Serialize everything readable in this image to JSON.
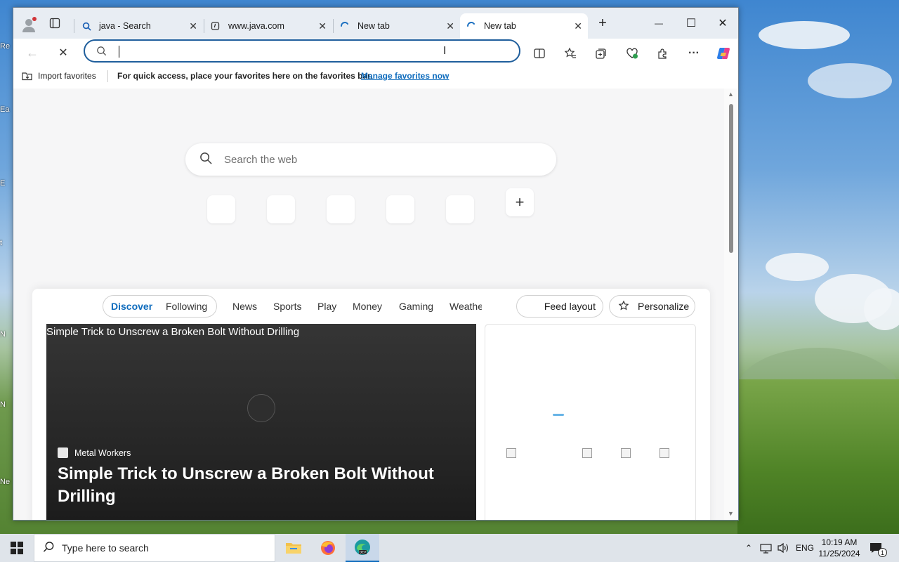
{
  "window": {
    "tabs": [
      {
        "title": "java - Search",
        "favicon": "search-icon"
      },
      {
        "title": "www.java.com",
        "favicon": "java-icon"
      },
      {
        "title": "New tab",
        "favicon": "loading-icon"
      },
      {
        "title": "New tab",
        "favicon": "loading-icon",
        "active": true
      }
    ],
    "new_tab_symbol": "+",
    "minimize_symbol": "—",
    "maximize_symbol": "☐",
    "close_symbol": "✕"
  },
  "toolbar": {
    "address_value": "",
    "stop_symbol": "✕",
    "more_symbol": "···"
  },
  "favorites_bar": {
    "import_label": "Import favorites",
    "prompt_text": "For quick access, place your favorites here on the favorites bar.",
    "manage_link": "Manage favorites now"
  },
  "new_tab_page": {
    "search_placeholder": "Search the web",
    "add_shortcut_symbol": "+",
    "feed": {
      "tabs": [
        "Discover",
        "Following",
        "News",
        "Sports",
        "Play",
        "Money",
        "Gaming",
        "Weathe"
      ],
      "feed_layout_label": "Feed layout",
      "personalize_label": "Personalize",
      "hero": {
        "alt_text": "Simple Trick to Unscrew a Broken Bolt Without Drilling",
        "source": "Metal Workers",
        "headline": "Simple Trick to Unscrew a Broken Bolt Without Drilling"
      }
    }
  },
  "taskbar": {
    "search_placeholder": "Type here to search",
    "language": "ENG",
    "time": "10:19 AM",
    "date": "11/25/2024",
    "notification_count": "1"
  },
  "colors": {
    "accent": "#0f6cbd",
    "address_border": "#1f5e9c",
    "taskbar": "#dfe4ea"
  }
}
